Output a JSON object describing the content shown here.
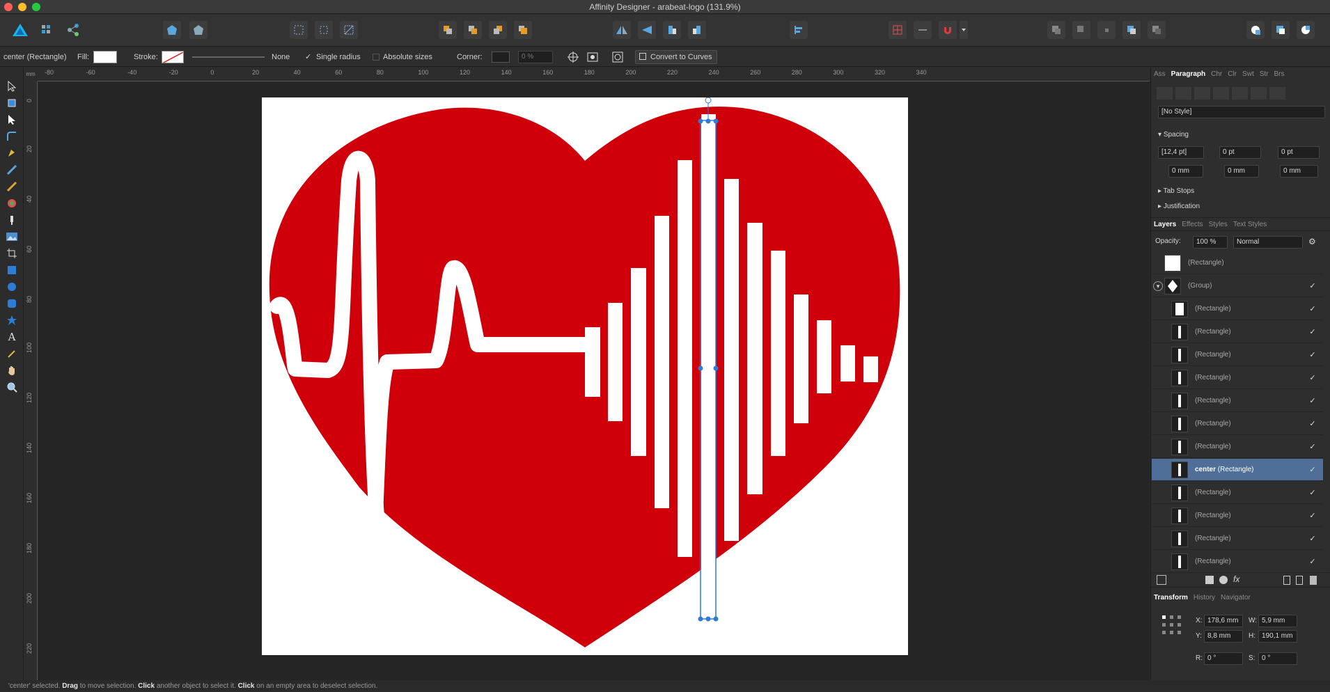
{
  "window": {
    "title": "Affinity Designer - arabeat-logo (131.9%)"
  },
  "context_bar": {
    "selection": "center (Rectangle)",
    "fill_label": "Fill:",
    "stroke_label": "Stroke:",
    "stroke_value": "None",
    "single_radius": "Single radius",
    "absolute_sizes": "Absolute sizes",
    "corner_label": "Corner:",
    "corner_value": "0 %",
    "convert_to_curves": "Convert to Curves"
  },
  "ruler": {
    "unit": "mm",
    "h_ticks": [
      "-80",
      "-60",
      "-40",
      "-20",
      "0",
      "20",
      "40",
      "60",
      "80",
      "100",
      "120",
      "140",
      "160",
      "180",
      "200",
      "220",
      "240",
      "260",
      "280",
      "300",
      "320",
      "340"
    ],
    "v_ticks": [
      "0",
      "20",
      "40",
      "60",
      "80",
      "100",
      "120",
      "140",
      "160",
      "180",
      "200",
      "220"
    ]
  },
  "panel": {
    "top_tabs": [
      "Ass",
      "Paragraph",
      "Chr",
      "Clr",
      "Swt",
      "Str",
      "Brs"
    ],
    "style_select": "[No Style]",
    "spacing_title": "Spacing",
    "spacing": {
      "leading": "[12,4 pt]",
      "before": "0 pt",
      "after": "0 pt",
      "left": "0 mm",
      "first": "0 mm",
      "right": "0 mm"
    },
    "tab_stops": "Tab Stops",
    "justification": "Justification",
    "layer_tabs": [
      "Layers",
      "Effects",
      "Styles",
      "Text Styles"
    ],
    "opacity_label": "Opacity:",
    "opacity_value": "100 %",
    "blend_mode": "Normal",
    "layers": [
      {
        "label": "(Rectangle)",
        "check": ""
      },
      {
        "label": "(Group)",
        "check": "✓"
      },
      {
        "label": "(Rectangle)",
        "check": "✓"
      },
      {
        "label": "(Rectangle)",
        "check": "✓"
      },
      {
        "label": "(Rectangle)",
        "check": "✓"
      },
      {
        "label": "(Rectangle)",
        "check": "✓"
      },
      {
        "label": "(Rectangle)",
        "check": "✓"
      },
      {
        "label": "(Rectangle)",
        "check": "✓"
      },
      {
        "label": "(Rectangle)",
        "check": "✓"
      },
      {
        "label_bold": "center",
        "label": "(Rectangle)",
        "check": "✓"
      },
      {
        "label": "(Rectangle)",
        "check": "✓"
      },
      {
        "label": "(Rectangle)",
        "check": "✓"
      },
      {
        "label": "(Rectangle)",
        "check": "✓"
      },
      {
        "label": "(Rectangle)",
        "check": "✓"
      }
    ],
    "bottom_tabs": [
      "Transform",
      "History",
      "Navigator"
    ],
    "transform": {
      "x_label": "X:",
      "x": "178,6 mm",
      "w_label": "W:",
      "w": "5,9 mm",
      "y_label": "Y:",
      "y": "8,8 mm",
      "h_label": "H:",
      "h": "190,1 mm",
      "r_label": "R:",
      "r": "0 °",
      "s_label": "S:",
      "s": "0 °"
    }
  },
  "status": {
    "p1": "'center' selected. ",
    "b1": "Drag",
    "p2": " to move selection. ",
    "b2": "Click",
    "p3": " another object to select it. ",
    "b3": "Click",
    "p4": " on an empty area to deselect selection."
  },
  "colors": {
    "heart": "#d0000b",
    "selection": "#2d7cd6",
    "accent": "#4f6f99"
  }
}
